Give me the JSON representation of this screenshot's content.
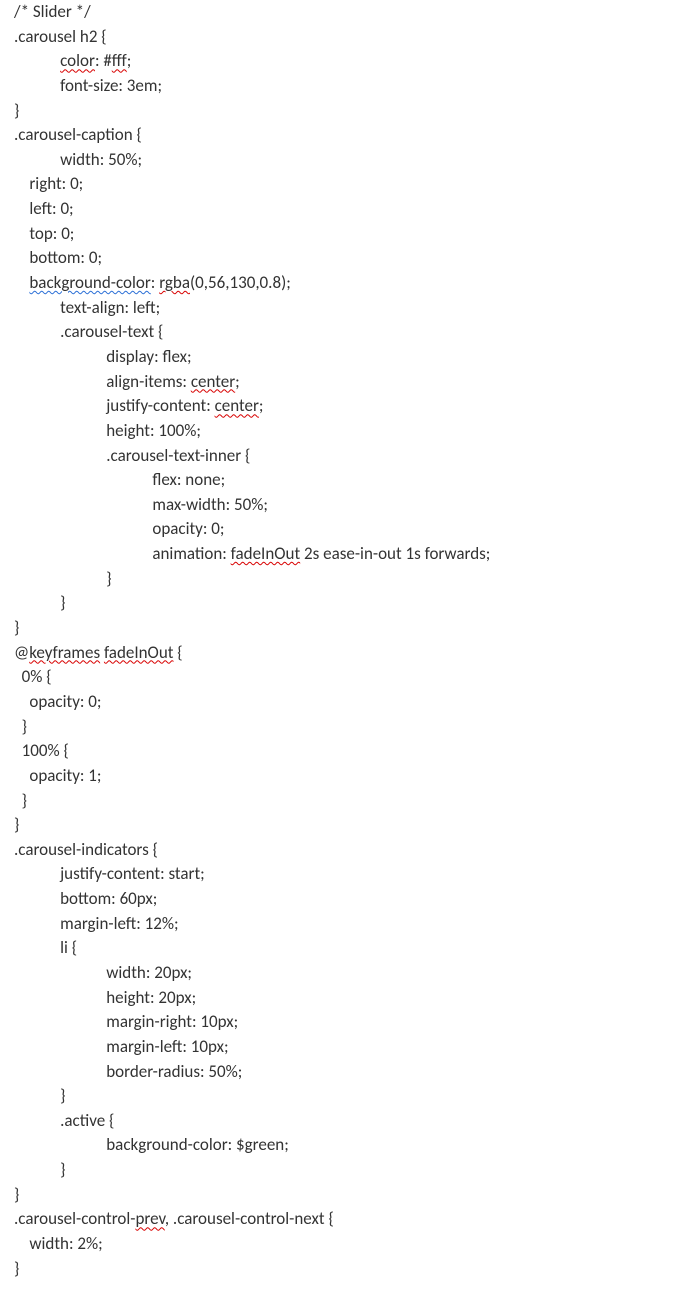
{
  "code": {
    "l1a": "/* Slider */",
    "l2a": ".carousel h2 {",
    "l3a": "            ",
    "l3b": "color",
    "l3c": ": #",
    "l3d": "fff",
    "l3e": ";",
    "l4a": "            font-size: 3em;",
    "l5a": "}",
    "l6a": ".carousel-caption {",
    "l7a": "            width: 50%;",
    "l8a": "    right: 0;",
    "l9a": "    left: 0;",
    "l10a": "    top: 0;",
    "l11a": "    bottom: 0;",
    "l12a": "    ",
    "l12b": "background-color",
    "l12c": ": ",
    "l12d": "rgba",
    "l12e": "(0,56,130,0.8);",
    "l13a": "            text-align: left;",
    "l14a": "            .carousel-text {",
    "l15a": "                        display: flex;",
    "l16a": "                        align-items: ",
    "l16b": "center",
    "l16c": ";",
    "l17a": "                        justify-content: ",
    "l17b": "center",
    "l17c": ";",
    "l18a": "                        height: 100%;",
    "l19a": "                        .carousel-text-inner {",
    "l20a": "                                    flex: none;",
    "l21a": "                                    max-width: 50%;",
    "l22a": "                                    opacity: 0;",
    "l23a": "                                    animation: ",
    "l23b": "fadeInOut",
    "l23c": " 2s ease-in-out 1s forwards;",
    "l24a": "                        }",
    "l25a": "            }",
    "l26a": "}",
    "l27a": "@",
    "l27b": "keyframes",
    "l27c": " ",
    "l27d": "fadeInOut",
    "l27e": " {",
    "l28a": "  0% {",
    "l29a": "    opacity: 0;",
    "l30a": "  }",
    "l31a": "  100% {",
    "l32a": "    opacity: 1;",
    "l33a": "  }",
    "l34a": "}",
    "l35a": ".carousel-indicators {",
    "l36a": "            justify-content: start;",
    "l37a": "            bottom: 60px;",
    "l38a": "            margin-left: 12%;",
    "l39a": "            li {",
    "l40a": "                        width: 20px;",
    "l41a": "                        height: 20px;",
    "l42a": "                        margin-right: 10px;",
    "l43a": "                        margin-left: 10px;",
    "l44a": "                        border-radius: 50%;",
    "l45a": "            }",
    "l46a": "            .active {",
    "l47a": "                        background-color: $green;",
    "l48a": "            }",
    "l49a": "}",
    "l50a": ".carousel-control-",
    "l50b": "prev",
    "l50c": ", .carousel-control-next {",
    "l51a": "    width: 2%;",
    "l52a": "}"
  }
}
